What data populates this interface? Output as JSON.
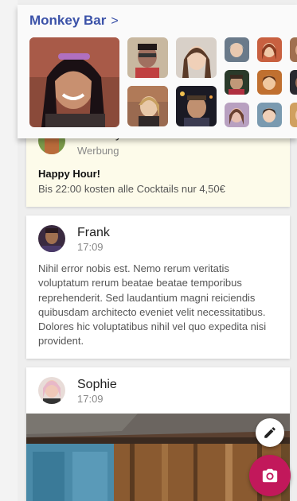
{
  "header": {
    "title": "Monkey Bar",
    "chevron": ">"
  },
  "feed": {
    "ad": {
      "name": "Monkey Bar",
      "label": "Werbung",
      "headline": "Happy Hour!",
      "text": "Bis 22:00 kosten alle Cocktails nur 4,50€"
    },
    "post1": {
      "name": "Frank",
      "time": "17:09",
      "text": "Nihil error nobis est. Nemo rerum veritatis voluptatum rerum beatae beatae temporibus reprehenderit. Sed laudantium magni reiciendis quibusdam architecto eveniet velit necessitatibus. Dolores hic voluptatibus nihil vel quo expedita nisi provident."
    },
    "post2": {
      "name": "Sophie",
      "time": "17:09"
    }
  },
  "actions": {
    "edit_icon": "pencil-icon",
    "camera_icon": "camera-icon"
  },
  "colors": {
    "title": "#3b52a8",
    "fab_primary": "#c2185b",
    "ad_background": "#fdfbea"
  }
}
